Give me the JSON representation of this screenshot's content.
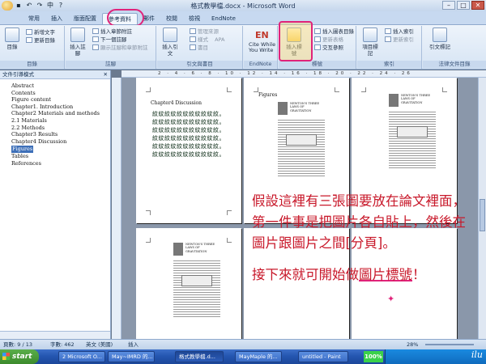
{
  "window": {
    "title": "格式教學檔.docx - Microsoft Word",
    "controls": [
      "–",
      "□",
      "✕"
    ]
  },
  "ribbon_tabs": [
    "常用",
    "插入",
    "版面配置",
    "參考資料",
    "郵件",
    "校閱",
    "檢視",
    "EndNote"
  ],
  "active_tab": "參考資料",
  "ribbon": {
    "toc": {
      "big_label": "目錄",
      "small": [
        "新增文字",
        "更新目錄"
      ],
      "group_label": "目錄"
    },
    "footnotes": {
      "big_label": "插入註腳",
      "small": [
        "插入章節附註",
        "下一個註腳",
        "顯示註腳和章節附註"
      ],
      "group_label": "註腳"
    },
    "citations": {
      "big_label": "插入引文",
      "small": [
        "管理來源",
        "樣式",
        "書目"
      ],
      "style_value": "APA",
      "group_label": "引文與書目"
    },
    "endnote": {
      "logo": "EN",
      "big_label": "Cite While You Write",
      "group_label": "EndNote"
    },
    "captions": {
      "big_label": "插入標號",
      "small": [
        "插入圖表目錄",
        "更新表格",
        "交互參照"
      ],
      "group_label": "標號"
    },
    "index": {
      "big_label": "項目標記",
      "small": [
        "插入索引",
        "更新索引"
      ],
      "group_label": "索引"
    },
    "toa": {
      "big_label": "引文標記",
      "group_label": "法律文件目錄"
    }
  },
  "nav_pane": {
    "title": "文件引導模式",
    "items": [
      "Abstract",
      "Contents",
      "Figure content",
      "Chapter1. Introduction",
      "Chapter2 Materials and methods",
      "2.1 Materials",
      "2.2 Methods",
      "Chapter3 Results",
      "Chapter4 Discussion",
      "Figures",
      "Tables",
      "References"
    ],
    "selected": "Figures"
  },
  "ruler_numbers": "2 · 4 · 6 · 8 · 10 · 12 · 14 · 16 · 18 · 20 · 22 · 24 · 26",
  "pages": {
    "page1_heading": "Chapter4 Discussion",
    "page1_line": "紋紋紋紋紋紋紋紋紋紋紋。",
    "page1_line_count": 6,
    "page2_heading": "Figures",
    "figure_title": "NEWTON'S THREE LAWS OF GRAVITATION"
  },
  "annotation": {
    "para1": "假設這裡有三張圖要放在論文裡面，第一件事是把圖片各自貼上，然後在圖片跟圖片之間[分頁]。",
    "para2_pre": "接下來就可開始做",
    "para2_hl": "圖片標號",
    "para2_post": "！",
    "color": "#c8182a",
    "highlight_color": "#e0237a"
  },
  "status_bar": {
    "page": "頁數: 9 / 13",
    "words": "字數: 462",
    "language": "英文 (美國)",
    "mode": "插入",
    "zoom": "28%"
  },
  "taskbar": {
    "start": "start",
    "buttons": [
      "2 Microsoft O...",
      "May~IMRD 的...",
      "格式教學檔.d...",
      "MayMaple 的...",
      "untitled - Paint"
    ],
    "zoom_badge": "100%",
    "signature": "ilu"
  }
}
